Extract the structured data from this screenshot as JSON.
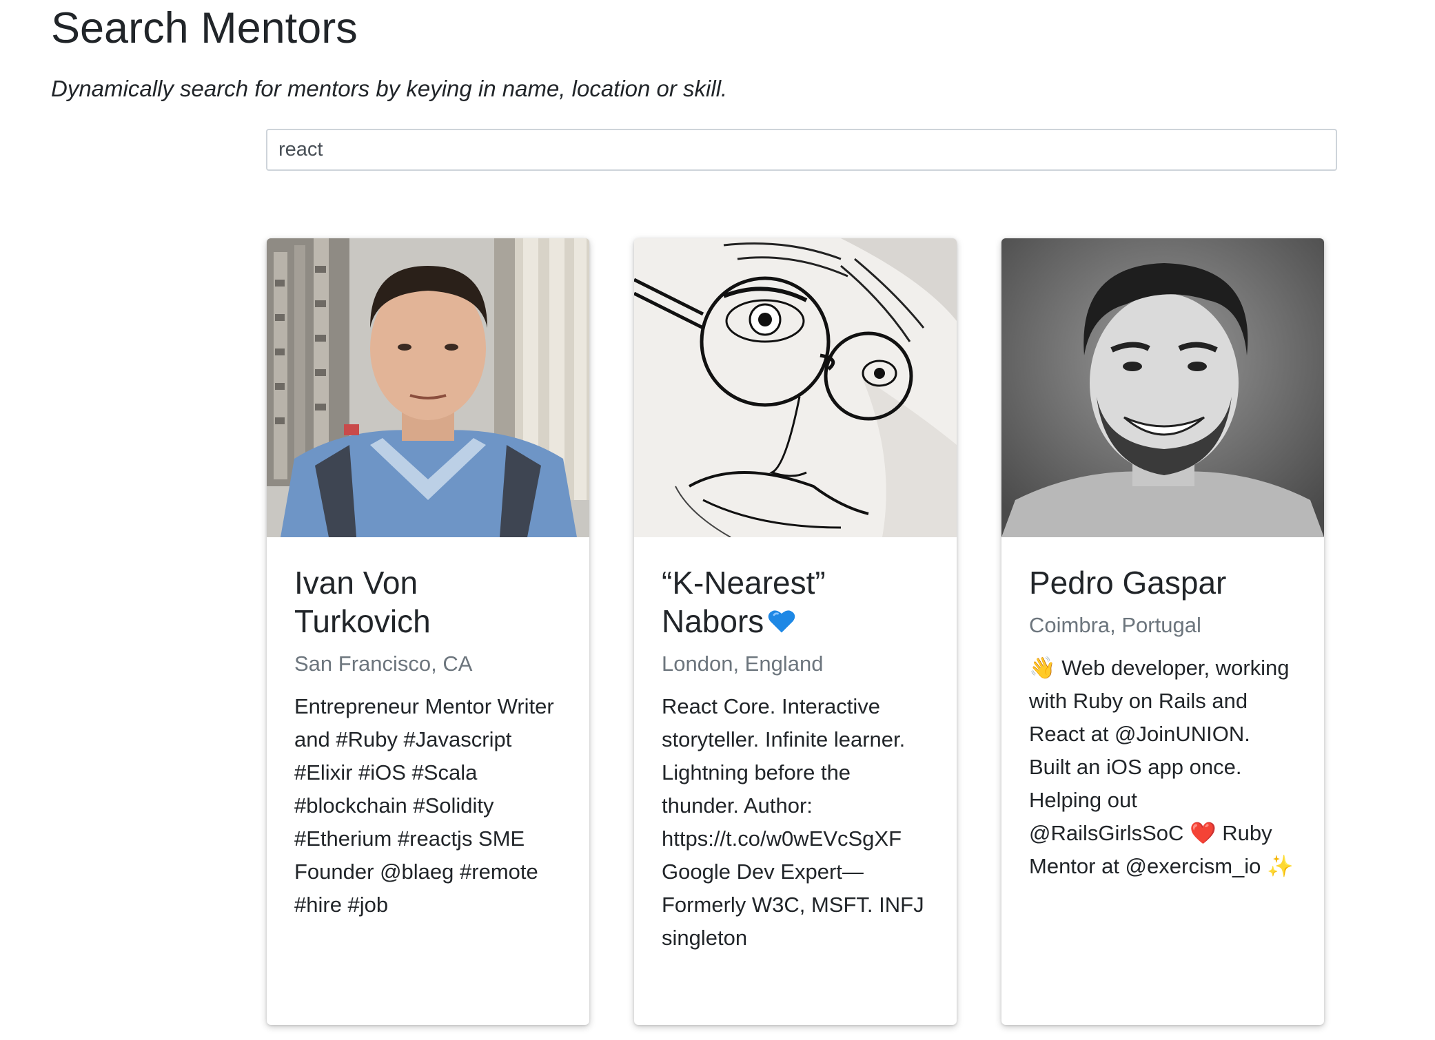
{
  "page": {
    "title": "Search Mentors",
    "subtitle": "Dynamically search for mentors by keying in name, location or skill."
  },
  "search": {
    "value": "react",
    "placeholder": ""
  },
  "mentors": [
    {
      "name": "Ivan Von Turkovich",
      "location": "San Francisco, CA",
      "bio": "Entrepreneur Mentor Writer and #Ruby #Javascript #Elixir #iOS #Scala #blockchain #Solidity #Etherium #reactjs SME Founder @blaeg #remote #hire #job"
    },
    {
      "name": "“K-Nearest” Nabors",
      "name_emoji": "blue-heart-icon",
      "location": "London, England",
      "bio": "React Core. Interactive storyteller. Infinite learner. Lightning before the thunder. Author: https://t.co/w0wEVcSgXF Google Dev Expert—Formerly W3C, MSFT. INFJ singleton"
    },
    {
      "name": "Pedro Gaspar",
      "location": "Coimbra, Portugal",
      "bio_parts": {
        "wave": "👋",
        "part1": " Web developer, working with Ruby on Rails and React at @JoinUNION. Built an iOS app once. Helping out @RailsGirlsSoC ",
        "heart": "❤️",
        "part2": " Ruby Mentor at @exercism_io ",
        "sparkles": "✨"
      }
    }
  ],
  "colors": {
    "text": "#212529",
    "muted": "#6c757d",
    "input_border": "#ced4da",
    "blue_heart": "#1e88e5"
  }
}
